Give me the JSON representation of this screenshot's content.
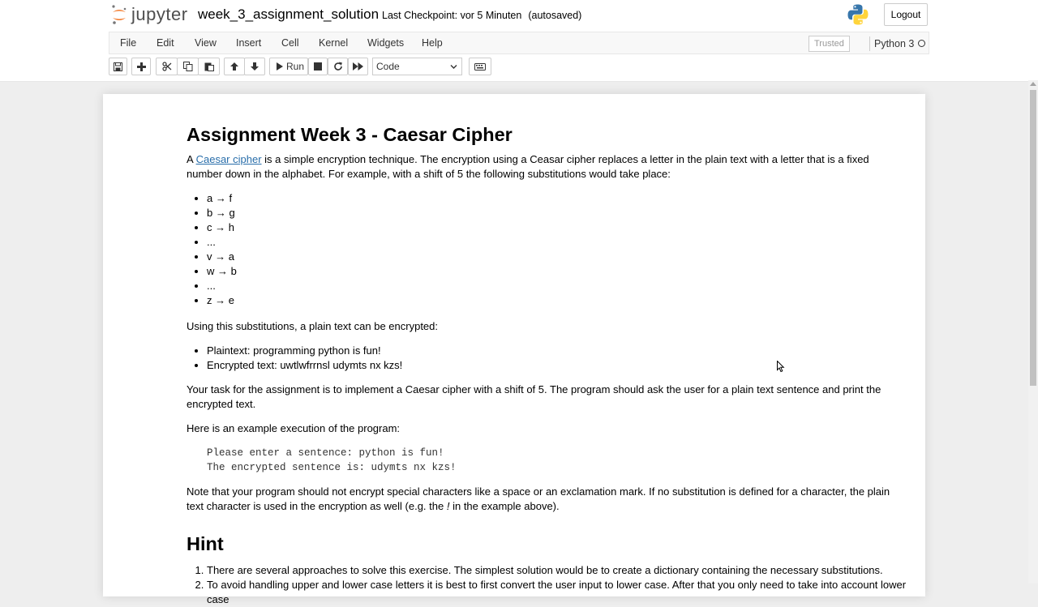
{
  "header": {
    "logo_text": "jupyter",
    "notebook_title": "week_3_assignment_solution",
    "checkpoint": "Last Checkpoint: vor 5 Minuten",
    "autosaved": "(autosaved)",
    "logout": "Logout"
  },
  "menu": {
    "items": [
      "File",
      "Edit",
      "View",
      "Insert",
      "Cell",
      "Kernel",
      "Widgets",
      "Help"
    ],
    "trusted": "Trusted",
    "kernel": "Python 3"
  },
  "toolbar": {
    "run_label": "Run",
    "cell_type": "Code",
    "icons": [
      "save-icon",
      "plus-icon",
      "scissors-icon",
      "copy-icon",
      "paste-icon",
      "arrow-up-icon",
      "arrow-down-icon",
      "play-icon",
      "stop-icon",
      "restart-icon",
      "fast-forward-icon",
      "keyboard-icon"
    ]
  },
  "notebook": {
    "title": "Assignment Week 3 - Caesar Cipher",
    "intro_a": "A",
    "intro_link": "Caesar cipher",
    "intro_rest": "is a simple encryption technique. The encryption using a Ceasar cipher replaces a letter in the plain text with a letter that is a fixed number down in the alphabet. For example, with a shift of 5 the following substitutions would take place:",
    "substitutions": [
      "a → f",
      "b → g",
      "c → h",
      "...",
      "v → a",
      "w → b",
      "...",
      "z → e"
    ],
    "using_text": "Using this substitutions, a plain text can be encrypted:",
    "examples": [
      "Plaintext: programming python is fun!",
      "Encrypted text: uwtlwfrrnsl udymts nx kzs!"
    ],
    "task": "Your task for the assignment is to implement a Caesar cipher with a shift of 5. The program should ask the user for a plain text sentence and print the encrypted text.",
    "example_intro": "Here is an example execution of the program:",
    "code_lines": [
      "Please enter a sentence: python is fun!",
      "The encrypted sentence is: udymts nx kzs!"
    ],
    "note_before": "Note that your program should not encrypt special characters like a space or an exclamation mark. If no substitution is defined for a character, the plain text character is used in the encryption as well (e.g. the",
    "note_em": "!",
    "note_after": "in the example above).",
    "hint_title": "Hint",
    "hints": [
      "There are several approaches to solve this exercise. The simplest solution would be to create a dictionary containing the necessary substitutions.",
      "To avoid handling upper and lower case letters it is best to first convert the user input to lower case. After that you only need to take into account lower case"
    ]
  },
  "colors": {
    "link": "#296eaa",
    "python_blue": "#3776ab",
    "python_yellow": "#ffd43b",
    "jupyter_orange": "#f37726"
  }
}
